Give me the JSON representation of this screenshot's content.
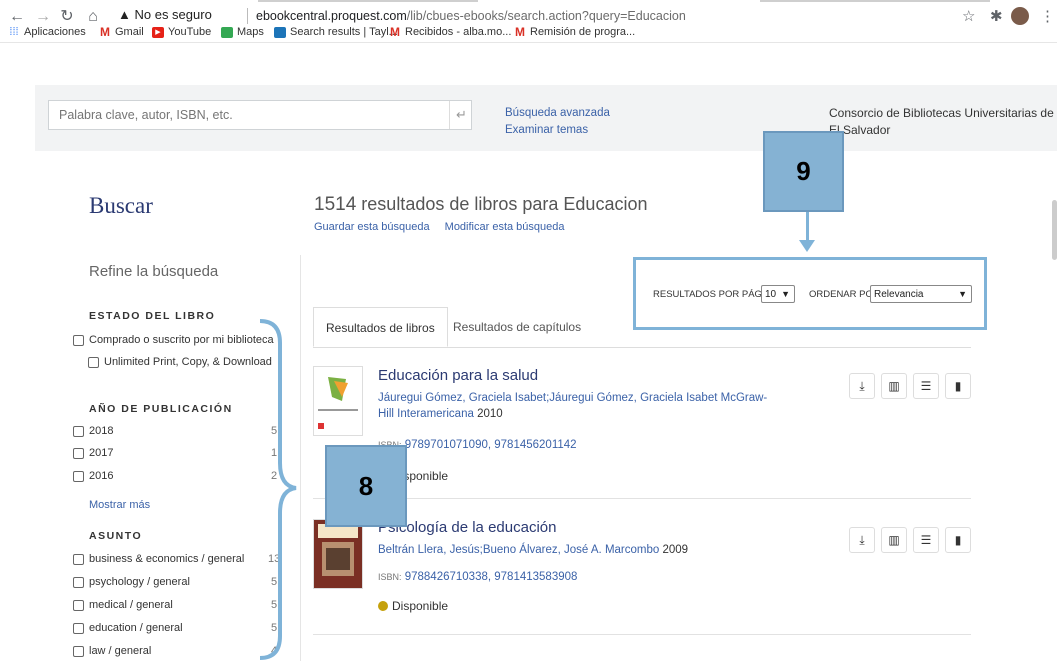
{
  "browser": {
    "url_warning": "▲ No es seguro",
    "url_host": "ebookcentral.proquest.com",
    "url_path": "/lib/cbues-ebooks/search.action?query=Educacion",
    "bookmarks": [
      "Aplicaciones",
      "Gmail",
      "YouTube",
      "Maps",
      "Search results | Tayl...",
      "Recibidos - alba.mo...",
      "Remisión de progra..."
    ]
  },
  "search": {
    "placeholder": "Palabra clave, autor, ISBN, etc.",
    "advanced_link": "Búsqueda avanzada",
    "browse_link": "Examinar temas",
    "consortium": "Consorcio de Bibliotecas Universitarias de El Salvador"
  },
  "page": {
    "buscar": "Buscar",
    "results_count": "1514",
    "results_text": "resultados de libros para Educacion",
    "save_search": "Guardar esta búsqueda",
    "modify_search": "Modificar esta búsqueda"
  },
  "filters": {
    "refine_title": "Refine la búsqueda",
    "estado_title": "ESTADO DEL LIBRO",
    "estado_items": [
      "Comprado o suscrito por mi biblioteca",
      "Unlimited Print, Copy, & Download"
    ],
    "anio_title": "AÑO DE PUBLICACIÓN",
    "anio_items": [
      {
        "label": "2018",
        "count": "5"
      },
      {
        "label": "2017",
        "count": "1"
      },
      {
        "label": "2016",
        "count": "2"
      }
    ],
    "show_more": "Mostrar más",
    "asunto_title": "ASUNTO",
    "asunto_items": [
      {
        "label": "business & economics / general",
        "count": "13"
      },
      {
        "label": "psychology / general",
        "count": "5"
      },
      {
        "label": "medical / general",
        "count": "5"
      },
      {
        "label": "education / general",
        "count": "5"
      },
      {
        "label": "law / general",
        "count": "4"
      }
    ]
  },
  "sort": {
    "per_page_label": "RESULTADOS POR PÁGINA",
    "per_page_value": "10",
    "order_label": "ORDENAR POR",
    "order_value": "Relevancia"
  },
  "tabs": {
    "books": "Resultados de libros",
    "chapters": "Resultados de capítulos"
  },
  "results": [
    {
      "title": "Educación para la salud",
      "authors": "Jáuregui Gómez, Graciela Isabet;Jáuregui Gómez, Graciela Isabet",
      "publisher": "McGraw-Hill Interamericana",
      "year": "2010",
      "isbn_label": "ISBN:",
      "isbn": "9789701071090, 9781456201142",
      "availability": "Disponible"
    },
    {
      "title": "Psicología de la educación",
      "authors": "Beltrán Llera, Jesús;Bueno Álvarez, José A.",
      "publisher": "Marcombo",
      "year": "2009",
      "isbn_label": "ISBN:",
      "isbn": "9788426710338, 9781413583908",
      "availability": "Disponible"
    }
  ],
  "annotations": {
    "callout_9": "9",
    "callout_8": "8",
    "color": "#85b2d3"
  }
}
